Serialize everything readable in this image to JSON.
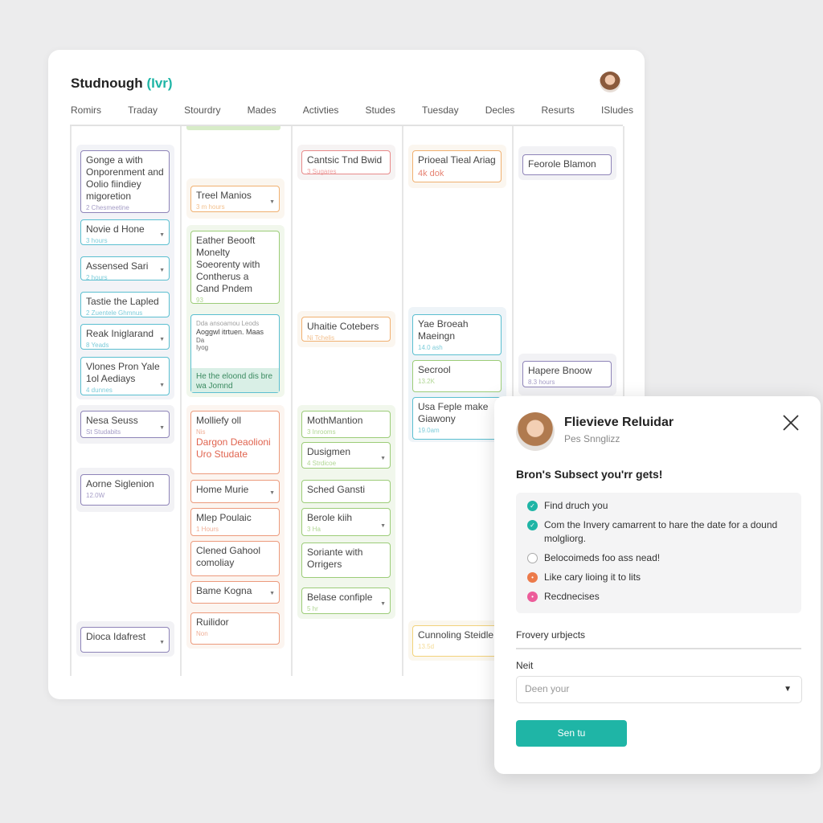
{
  "app": {
    "title": "Studnough",
    "title_accent": "(Ivr)"
  },
  "tabs": [
    "Romirs",
    "Traday",
    "Stourdry",
    "Mades",
    "Activties",
    "Studes",
    "Tuesday",
    "Decles",
    "Resurts",
    "ISludes"
  ],
  "colors": {
    "accent": "#1fb5a6",
    "purple": "#8e84b8",
    "teal": "#5bbfd0",
    "orange": "#f0b070",
    "green": "#9ccc78",
    "red": "#e88a8a",
    "coral": "#ec9a7c",
    "yellow": "#f2d27a"
  },
  "columns": [
    {
      "groups": [
        {
          "bg": "#f2f3f7",
          "cards": [
            {
              "title": "Gonge a with Onporenment and Oolio fiindiey migoretion",
              "sub": "2 Chesmeetine",
              "color": "purple"
            },
            {
              "title": "Novie d Hone",
              "sub": "3 hours",
              "color": "teal",
              "chev": true
            },
            {
              "title": "Assensed Sari",
              "sub": "2 hours",
              "color": "teal",
              "chev": true
            },
            {
              "title": "Tastie the Lapled",
              "sub": "2 Zuentele Ghmnus",
              "color": "teal"
            },
            {
              "title": "Reak Iniglarand",
              "sub": "8 Yeads",
              "color": "teal",
              "chev": true
            },
            {
              "title": "Vlones Pron Yale 1ol Aediays",
              "sub": "4 dunnes",
              "color": "teal",
              "chev": true
            }
          ]
        },
        {
          "bg": "#f2f2f5",
          "cards": [
            {
              "title": "Nesa Seuss",
              "sub": "St Studabits",
              "color": "purple",
              "chev": true
            }
          ]
        },
        {
          "bg": "#f2f2f5",
          "cards": [
            {
              "title": "Aorne Siglenion",
              "sub": "12.0W",
              "color": "purple"
            }
          ]
        },
        {
          "bg": "#f2f2f5",
          "cards": [
            {
              "title": "Dioca Idafrest",
              "sub": "",
              "color": "purple",
              "chev": true
            }
          ]
        }
      ]
    },
    {
      "groups": [
        {
          "bg": "#fbf6ef",
          "cards": [
            {
              "title": "Treel Manios",
              "sub": "3 m hours",
              "color": "orange",
              "chev": true
            }
          ]
        },
        {
          "bg": "#f1f7ec",
          "cards": [
            {
              "title": "Eather Beooft Monelty Soeorenty with Contherus a Cand Pndem",
              "sub": "93",
              "color": "green"
            },
            {
              "title": "Aoggwl itrtuen. Maas",
              "sub": "Dda ansoamou   Leods",
              "extra": "Da\nIyog",
              "footer": "He the eloond dis bre wa Jomnd",
              "color": "teal"
            }
          ]
        },
        {
          "bg": "#fcf5f0",
          "cards": [
            {
              "title": "Molliefy oll",
              "sub": "Nis",
              "red": "Dargon Deaolioni Uro Studate",
              "color": "coral"
            },
            {
              "title": "Home Murie",
              "sub": "",
              "color": "coral",
              "chev": true
            },
            {
              "title": "Mlep Poulaic",
              "sub": "1 Hours",
              "color": "coral"
            },
            {
              "title": "Clened Gahool comoliay",
              "sub": "",
              "color": "coral"
            },
            {
              "title": "Bame Kogna",
              "sub": "",
              "color": "coral",
              "chev": true
            },
            {
              "title": "Ruilidor",
              "sub": "Non",
              "color": "coral"
            }
          ]
        }
      ]
    },
    {
      "groups": [
        {
          "bg": "#f6f3f3",
          "cards": [
            {
              "title": "Cantsic Tnd Bwid",
              "sub": "3 Sugares",
              "color": "red"
            }
          ]
        },
        {
          "bg": "#fbf6ef",
          "cards": [
            {
              "title": "Uhaitie Cotebers",
              "sub": "Ni Tchelis",
              "color": "orange"
            }
          ]
        },
        {
          "bg": "#f1f7ec",
          "cards": [
            {
              "title": "MothMantion",
              "sub": "3 Inrooms",
              "color": "green"
            },
            {
              "title": "Dusigmen",
              "sub": "4 Strdicoe",
              "color": "green",
              "chev": true
            },
            {
              "title": "Sched Gansti",
              "sub": "",
              "color": "green"
            },
            {
              "title": "Berole kiih",
              "sub": "3 Ha",
              "color": "green",
              "chev": true
            },
            {
              "title": "Soriante with Orrigers",
              "sub": "",
              "color": "green"
            },
            {
              "title": "Belase confiple",
              "sub": "5 hr",
              "color": "green",
              "chev": true
            }
          ]
        }
      ]
    },
    {
      "groups": [
        {
          "bg": "#fbf6ef",
          "cards": [
            {
              "title": "Prioeal Tieal Ariag",
              "sub": "4k dok",
              "color": "orange",
              "subcolor": "#e0644f"
            }
          ]
        },
        {
          "bg": "#eef4f8",
          "cards": [
            {
              "title": "Yae Broeah Maeingn",
              "sub": "14.0 ash",
              "color": "teal"
            },
            {
              "title": "Secrool",
              "sub": "13.2K",
              "color": "green"
            },
            {
              "title": "Usa Feple make Giawony",
              "sub": "19.0am",
              "color": "teal"
            }
          ]
        },
        {
          "bg": "#fbf7ee",
          "cards": [
            {
              "title": "Cunnoling Steidle",
              "sub": "13.5d",
              "color": "yellow"
            }
          ]
        }
      ]
    },
    {
      "groups": [
        {
          "bg": "#f2f2f5",
          "cards": [
            {
              "title": "Feorole Blamon",
              "sub": "",
              "color": "purple"
            }
          ]
        },
        {
          "bg": "#f2f2f5",
          "cards": [
            {
              "title": "Hapere Bnoow",
              "sub": "8.3 hours",
              "color": "purple"
            }
          ]
        }
      ]
    }
  ],
  "modal": {
    "name": "Flievieve Reluidar",
    "subtitle": "Pes Snnglizz",
    "heading": "Bron's Subsect you'rr gets!",
    "items": [
      {
        "text": "Find druch you",
        "status": "checked",
        "color": "#1fb5a6"
      },
      {
        "text": "Com the Invery camarrent to hare the date for a dound molgliorg.",
        "status": "checked",
        "color": "#1fb5a6"
      },
      {
        "text": "Belocoimeds foo ass nead!",
        "status": "empty",
        "color": "#ffffff"
      },
      {
        "text": "Like cary lioing it to lits",
        "status": "partial",
        "color": "#ec7a4a"
      },
      {
        "text": "Recdnecises",
        "status": "partial",
        "color": "#ec5c9a"
      }
    ],
    "field1_label": "Frovery urbjects",
    "field2_label": "Neit",
    "select_placeholder": "Deen your",
    "button_label": "Sen tu"
  }
}
